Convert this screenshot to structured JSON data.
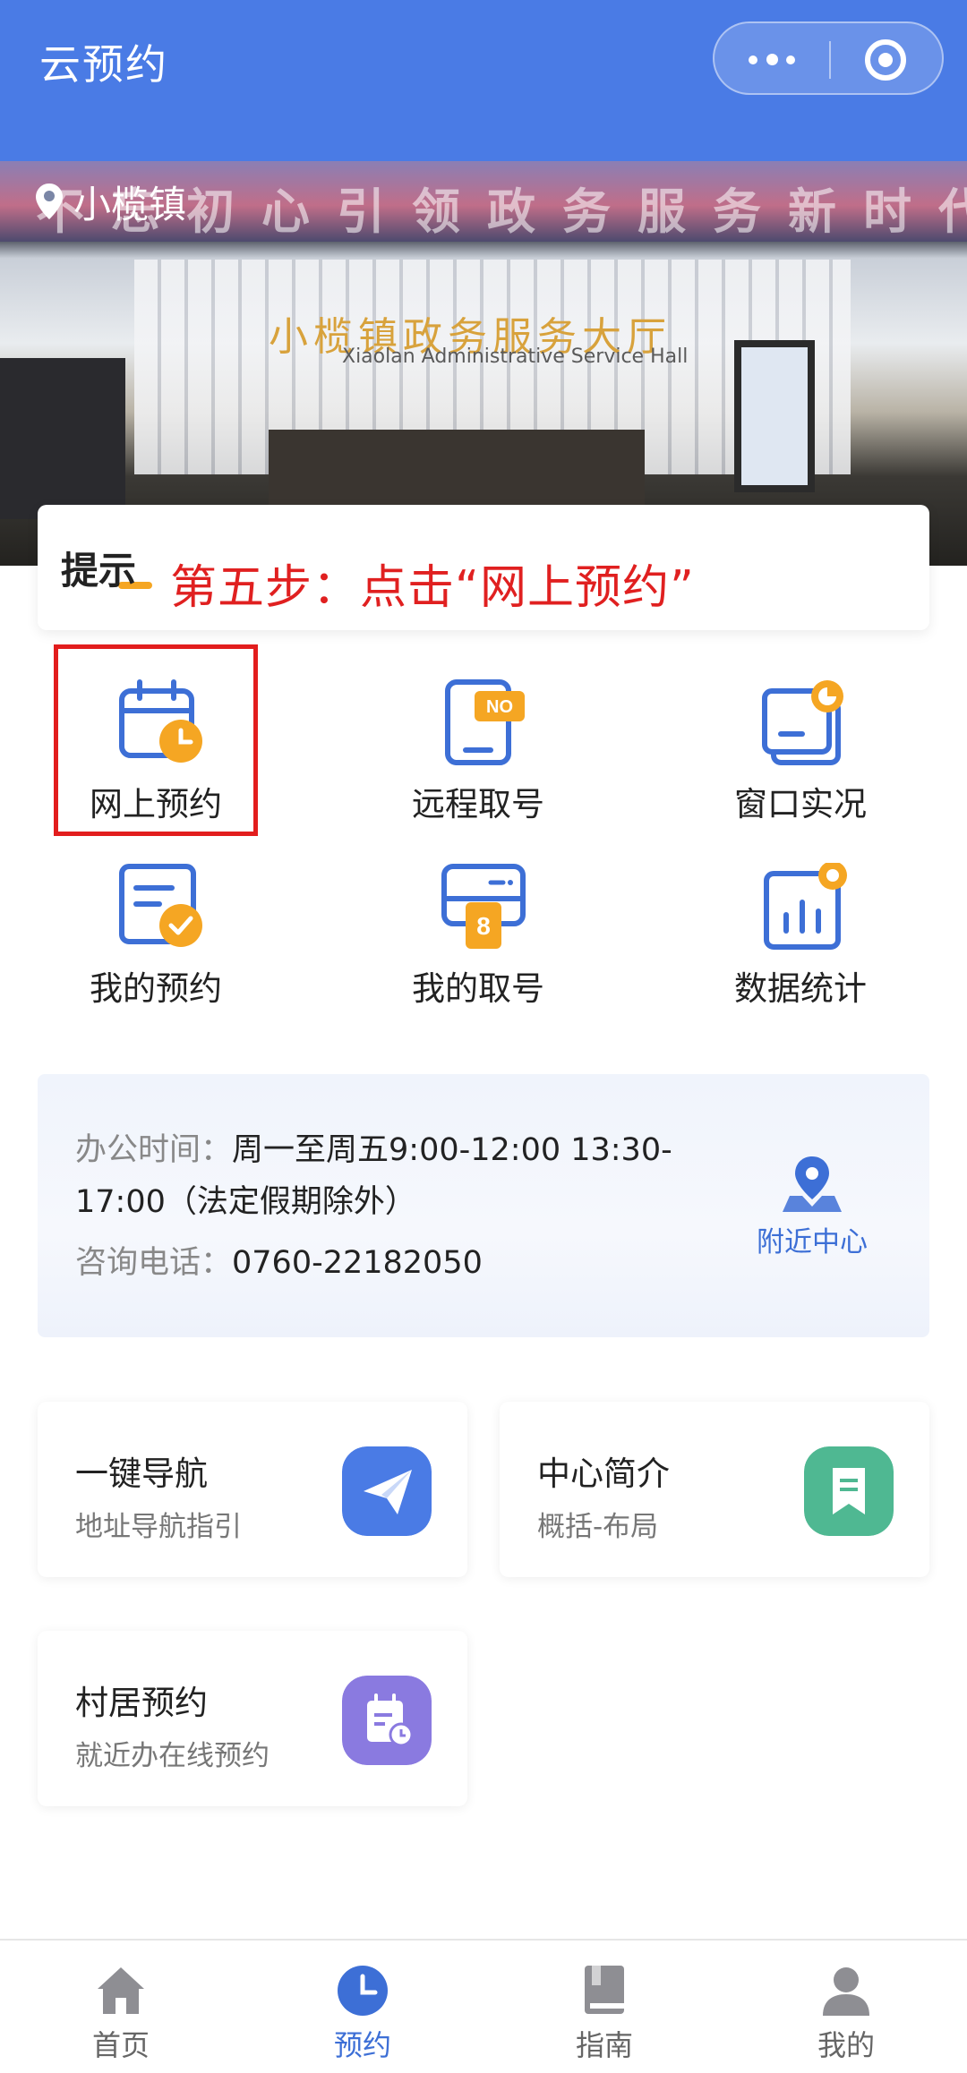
{
  "header": {
    "title": "云预约"
  },
  "banner": {
    "location": "小榄镇",
    "slogan": "不忘初心引领政务服务新时代",
    "hall_name": "小榄镇政务服务大厅",
    "hall_name_en": "Xiaolan Administrative Service Hall"
  },
  "tip": {
    "title": "提示",
    "annotation": "第五步：点击“网上预约”"
  },
  "grid": {
    "items": [
      {
        "label": "网上预约",
        "icon": "calendar-clock-icon"
      },
      {
        "label": "远程取号",
        "icon": "phone-ticket-icon"
      },
      {
        "label": "窗口实况",
        "icon": "window-live-icon"
      },
      {
        "label": "我的预约",
        "icon": "document-check-icon"
      },
      {
        "label": "我的取号",
        "icon": "queue-number-icon"
      },
      {
        "label": "数据统计",
        "icon": "bar-chart-icon"
      }
    ],
    "queue_number": "8",
    "no_badge": "NO"
  },
  "info": {
    "hours_label": "办公时间：",
    "hours_value_line1": "周一至周五9:00-12:00 13:30-",
    "hours_value_line2": "17:00（法定假期除外）",
    "phone_label": "咨询电话：",
    "phone_value": "0760-22182050",
    "nearby_label": "附近中心"
  },
  "quick": {
    "items": [
      {
        "title": "一键导航",
        "sub": "地址导航指引",
        "icon": "paper-plane-icon",
        "color": "#4a7be5"
      },
      {
        "title": "中心简介",
        "sub": "概括-布局",
        "icon": "bookmark-doc-icon",
        "color": "#4fb892"
      },
      {
        "title": "村居预约",
        "sub": "就近办在线预约",
        "icon": "calendar-doc-icon",
        "color": "#8a7ae0"
      }
    ]
  },
  "tabbar": {
    "items": [
      {
        "label": "首页",
        "icon": "home-icon",
        "active": false
      },
      {
        "label": "预约",
        "icon": "clock-icon",
        "active": true
      },
      {
        "label": "指南",
        "icon": "book-icon",
        "active": false
      },
      {
        "label": "我的",
        "icon": "user-icon",
        "active": false
      }
    ]
  },
  "colors": {
    "primary": "#4a7be5",
    "accent_orange": "#f5a623",
    "annotation_red": "#e02020"
  }
}
